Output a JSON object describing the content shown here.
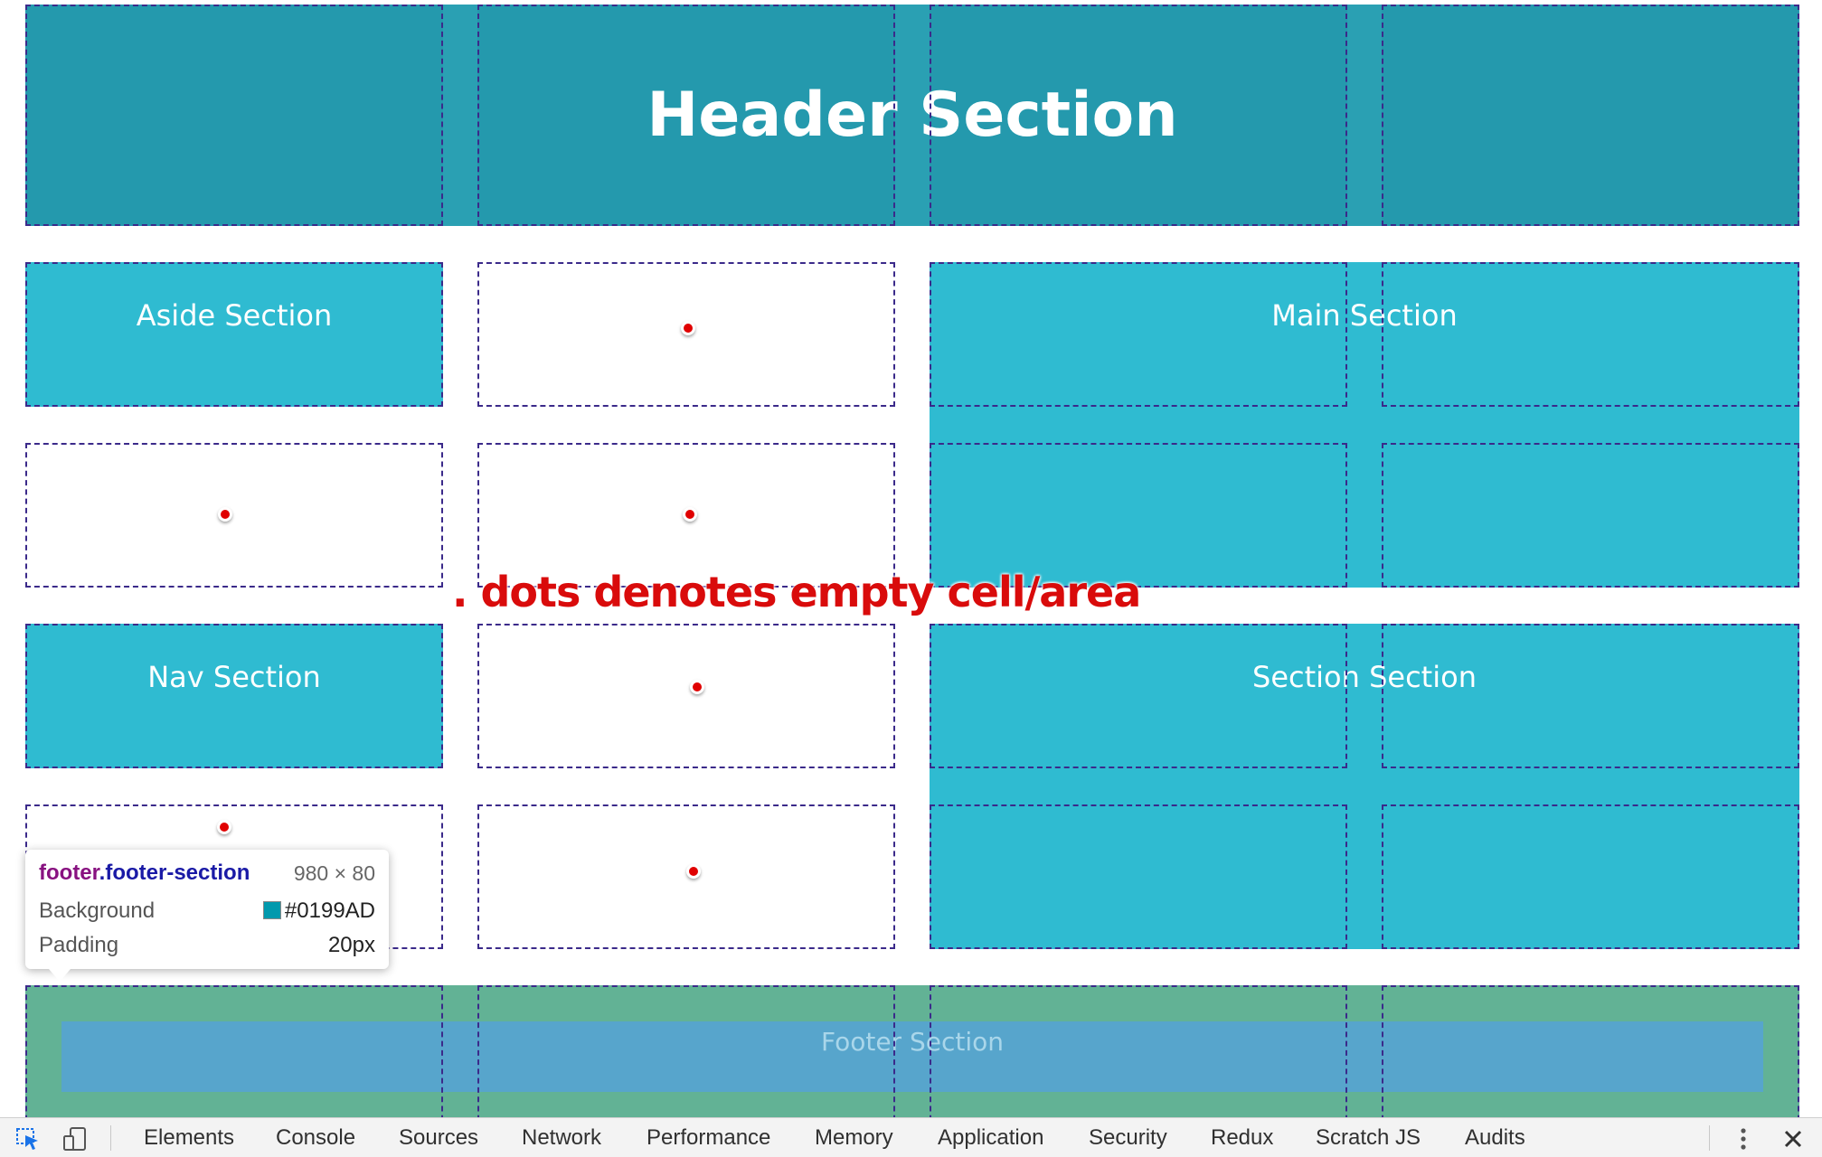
{
  "sections": {
    "header": "Header Section",
    "aside": "Aside Section",
    "main": "Main Section",
    "nav": "Nav Section",
    "section": "Section Section",
    "footer": "Footer Section"
  },
  "annotation": ". dots denotes empty cell/area",
  "tooltip": {
    "tag": "footer",
    "class": ".footer-section",
    "size": "980 × 80",
    "rows": [
      {
        "label": "Background",
        "value": "#0199AD",
        "swatch": "#0199AD"
      },
      {
        "label": "Padding",
        "value": "20px"
      }
    ]
  },
  "devtools": {
    "tabs": [
      "Elements",
      "Console",
      "Sources",
      "Network",
      "Performance",
      "Memory",
      "Application",
      "Security",
      "Redux",
      "Scratch JS",
      "Audits"
    ],
    "icons": [
      "inspect-element-icon",
      "device-toolbar-icon",
      "more-options-icon",
      "close-icon"
    ]
  },
  "colors": {
    "header": "#2499ad",
    "cell": "#2fbbd1",
    "footer_margin": "#62b295",
    "footer_content": "#57a5cc",
    "grid_line": "#3b2a8a",
    "dot": "#e00000"
  }
}
